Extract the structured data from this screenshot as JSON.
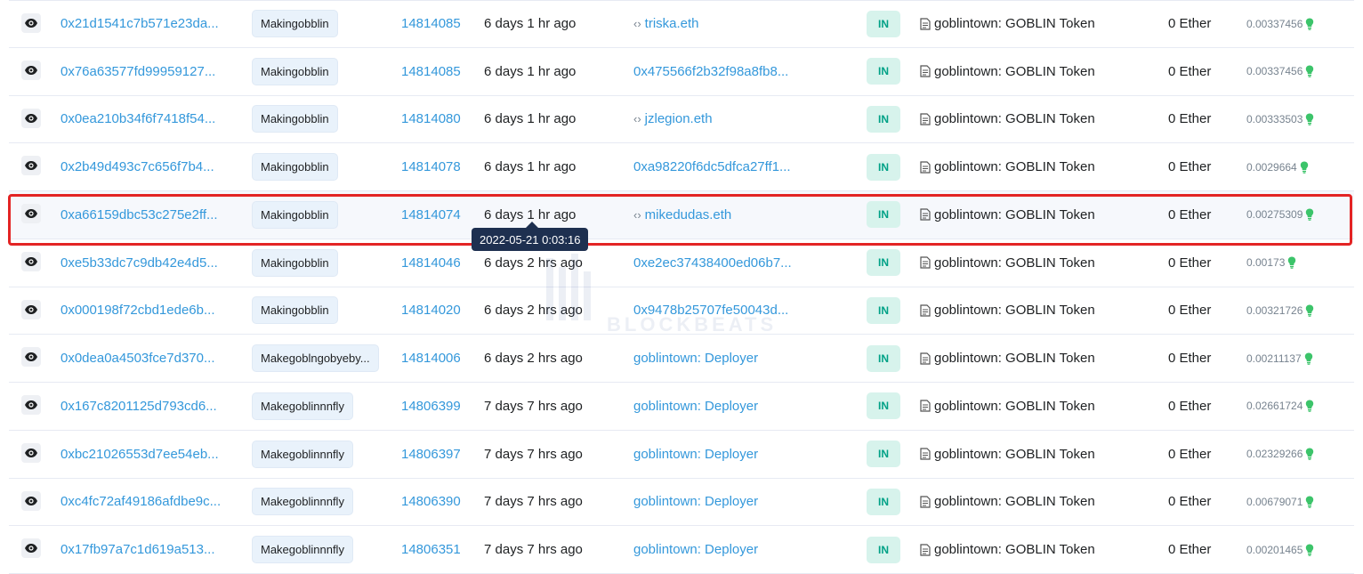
{
  "tooltip": {
    "text": "2022-05-21 0:03:16"
  },
  "watermark": {
    "brand": "BLOCKBEATS"
  },
  "colors": {
    "link": "#3498db",
    "in_badge_bg": "#d7f3ec",
    "in_badge_text": "#00a186",
    "highlight": "#e32424"
  },
  "rows": [
    {
      "hash": "0x21d1541c7b571e23da...",
      "method": "Makingobblin",
      "block": "14814085",
      "age": "6 days 1 hr ago",
      "from": "triska.eth",
      "from_ens": true,
      "direction": "IN",
      "to": "goblintown: GOBLIN Token",
      "value": "0 Ether",
      "fee": "0.00337456"
    },
    {
      "hash": "0x76a63577fd99959127...",
      "method": "Makingobblin",
      "block": "14814085",
      "age": "6 days 1 hr ago",
      "from": "0x475566f2b32f98a8fb8...",
      "from_ens": false,
      "direction": "IN",
      "to": "goblintown: GOBLIN Token",
      "value": "0 Ether",
      "fee": "0.00337456"
    },
    {
      "hash": "0x0ea210b34f6f7418f54...",
      "method": "Makingobblin",
      "block": "14814080",
      "age": "6 days 1 hr ago",
      "from": "jzlegion.eth",
      "from_ens": true,
      "direction": "IN",
      "to": "goblintown: GOBLIN Token",
      "value": "0 Ether",
      "fee": "0.00333503"
    },
    {
      "hash": "0x2b49d493c7c656f7b4...",
      "method": "Makingobblin",
      "block": "14814078",
      "age": "6 days 1 hr ago",
      "from": "0xa98220f6dc5dfca27ff1...",
      "from_ens": false,
      "direction": "IN",
      "to": "goblintown: GOBLIN Token",
      "value": "0 Ether",
      "fee": "0.0029664"
    },
    {
      "hash": "0xa66159dbc53c275e2ff...",
      "method": "Makingobblin",
      "block": "14814074",
      "age": "6 days 1 hr ago",
      "from": "mikedudas.eth",
      "from_ens": true,
      "direction": "IN",
      "to": "goblintown: GOBLIN Token",
      "value": "0 Ether",
      "fee": "0.00275309"
    },
    {
      "hash": "0xe5b33dc7c9db42e4d5...",
      "method": "Makingobblin",
      "block": "14814046",
      "age": "6 days 2 hrs ago",
      "from": "0xe2ec37438400ed06b7...",
      "from_ens": false,
      "direction": "IN",
      "to": "goblintown: GOBLIN Token",
      "value": "0 Ether",
      "fee": "0.00173"
    },
    {
      "hash": "0x000198f72cbd1ede6b...",
      "method": "Makingobblin",
      "block": "14814020",
      "age": "6 days 2 hrs ago",
      "from": "0x9478b25707fe50043d...",
      "from_ens": false,
      "direction": "IN",
      "to": "goblintown: GOBLIN Token",
      "value": "0 Ether",
      "fee": "0.00321726"
    },
    {
      "hash": "0x0dea0a4503fce7d370...",
      "method": "Makegoblngobyeby...",
      "block": "14814006",
      "age": "6 days 2 hrs ago",
      "from": "goblintown: Deployer",
      "from_ens": false,
      "direction": "IN",
      "to": "goblintown: GOBLIN Token",
      "value": "0 Ether",
      "fee": "0.00211137"
    },
    {
      "hash": "0x167c8201125d793cd6...",
      "method": "Makegoblinnnfly",
      "block": "14806399",
      "age": "7 days 7 hrs ago",
      "from": "goblintown: Deployer",
      "from_ens": false,
      "direction": "IN",
      "to": "goblintown: GOBLIN Token",
      "value": "0 Ether",
      "fee": "0.02661724"
    },
    {
      "hash": "0xbc21026553d7ee54eb...",
      "method": "Makegoblinnnfly",
      "block": "14806397",
      "age": "7 days 7 hrs ago",
      "from": "goblintown: Deployer",
      "from_ens": false,
      "direction": "IN",
      "to": "goblintown: GOBLIN Token",
      "value": "0 Ether",
      "fee": "0.02329266"
    },
    {
      "hash": "0xc4fc72af49186afdbe9c...",
      "method": "Makegoblinnnfly",
      "block": "14806390",
      "age": "7 days 7 hrs ago",
      "from": "goblintown: Deployer",
      "from_ens": false,
      "direction": "IN",
      "to": "goblintown: GOBLIN Token",
      "value": "0 Ether",
      "fee": "0.00679071"
    },
    {
      "hash": "0x17fb97a7c1d619a513...",
      "method": "Makegoblinnnfly",
      "block": "14806351",
      "age": "7 days 7 hrs ago",
      "from": "goblintown: Deployer",
      "from_ens": false,
      "direction": "IN",
      "to": "goblintown: GOBLIN Token",
      "value": "0 Ether",
      "fee": "0.00201465"
    }
  ]
}
